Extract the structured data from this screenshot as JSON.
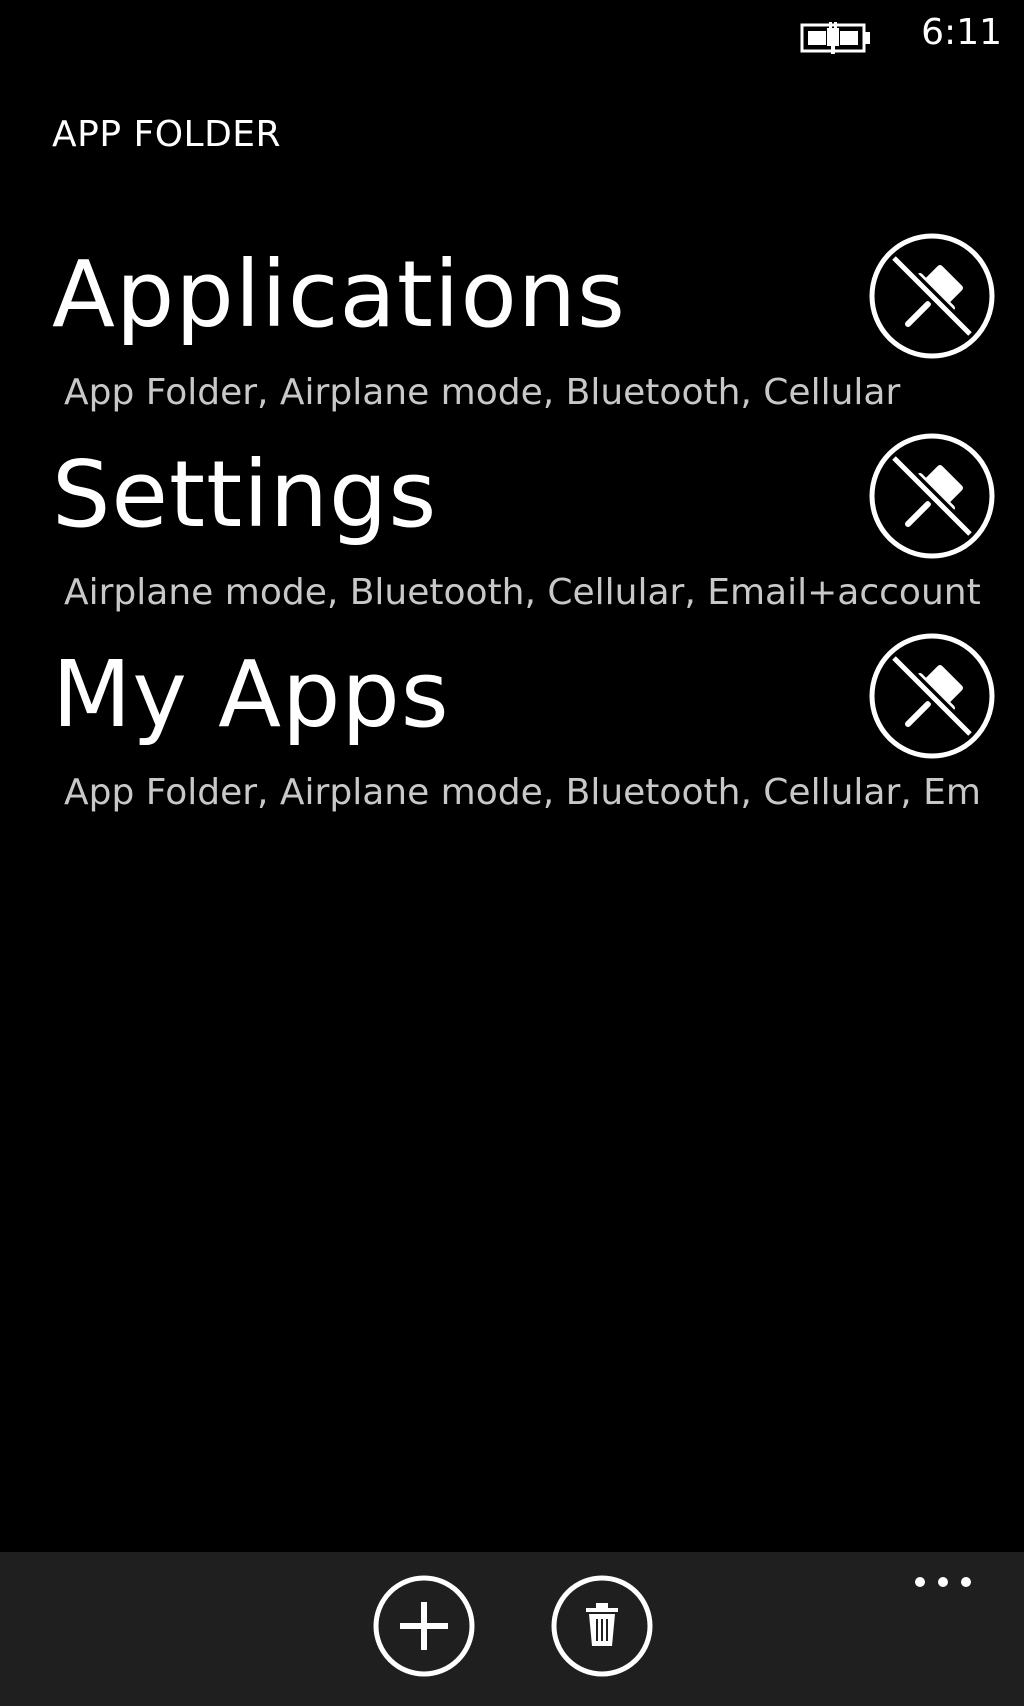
{
  "status_bar": {
    "time": "6:11",
    "battery_icon": "battery-charging-icon"
  },
  "header": {
    "title": "APP FOLDER"
  },
  "folders": [
    {
      "name": "Applications",
      "apps": "App Folder, Airplane mode, Bluetooth, Cellular",
      "action_icon": "unpin-icon"
    },
    {
      "name": "Settings",
      "apps": "Airplane mode, Bluetooth, Cellular, Email+account",
      "action_icon": "unpin-icon"
    },
    {
      "name": "My Apps",
      "apps": "App Folder, Airplane mode, Bluetooth, Cellular, Em",
      "action_icon": "unpin-icon"
    }
  ],
  "app_bar": {
    "buttons": [
      {
        "icon": "add-icon"
      },
      {
        "icon": "delete-icon"
      }
    ],
    "more_icon": "ellipsis-icon",
    "background": "#1f1f1f"
  },
  "colors": {
    "background": "#000000",
    "foreground": "#ffffff",
    "secondary_text": "#c8c8c8"
  }
}
